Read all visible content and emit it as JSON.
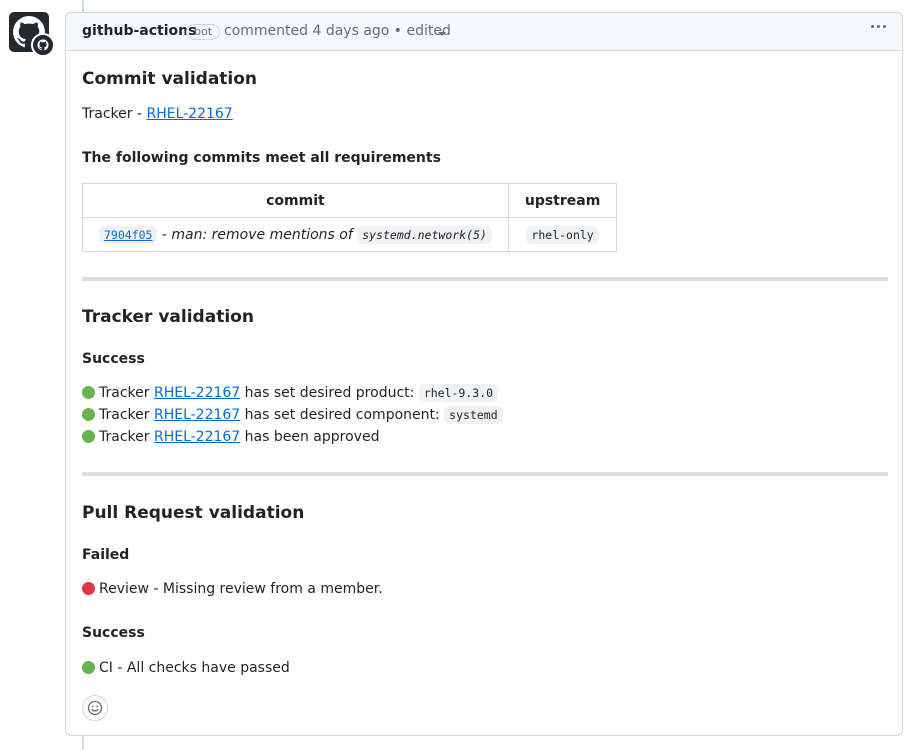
{
  "comment": {
    "author": "github-actions",
    "badge": "bot",
    "meta": "commented 4 days ago • edited"
  },
  "commit_validation": {
    "heading": "Commit validation",
    "tracker_prefix": "Tracker - ",
    "tracker_id": "RHEL-22167",
    "subheading": "The following commits meet all requirements",
    "table": {
      "headers": [
        "commit",
        "upstream"
      ],
      "rows": [
        {
          "hash": "7904f05",
          "separator": " - ",
          "message": "man: remove mentions of ",
          "code": "systemd.network(5)",
          "upstream": "rhel-only"
        }
      ]
    }
  },
  "tracker_validation": {
    "heading": "Tracker validation",
    "subheading": "Success",
    "items": [
      {
        "status": "success",
        "prefix": "Tracker ",
        "link": "RHEL-22167",
        "text": " has set desired product: ",
        "code": "rhel-9.3.0"
      },
      {
        "status": "success",
        "prefix": "Tracker ",
        "link": "RHEL-22167",
        "text": " has set desired component: ",
        "code": "systemd"
      },
      {
        "status": "success",
        "prefix": "Tracker ",
        "link": "RHEL-22167",
        "text": " has been approved",
        "code": ""
      }
    ]
  },
  "pr_validation": {
    "heading": "Pull Request validation",
    "failed_heading": "Failed",
    "failed_item": "Review - Missing review from a member.",
    "success_heading": "Success",
    "success_item": "CI - All checks have passed"
  },
  "colors": {
    "success": "#6bb252",
    "failure": "#e3334a",
    "link": "#0969da"
  },
  "icons": [
    "github-mark-icon",
    "kebab-icon",
    "chevron-down-icon",
    "smiley-icon"
  ]
}
